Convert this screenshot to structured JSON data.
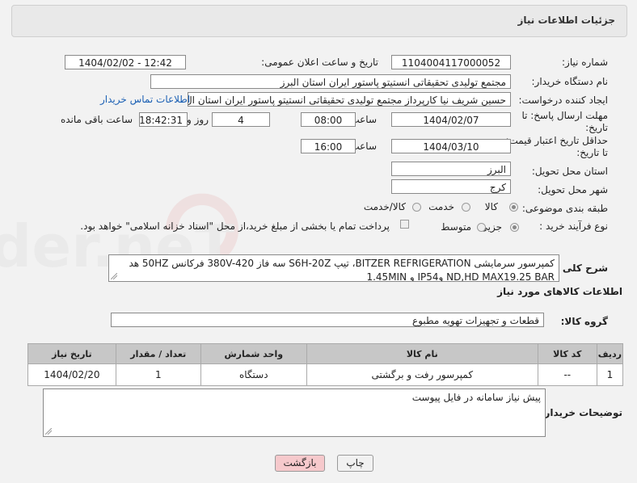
{
  "header": {
    "title": "جزئیات اطلاعات نیاز"
  },
  "need_number": {
    "label": "شماره نیاز:",
    "value": "1104004117000052"
  },
  "announce_datetime": {
    "label": "تاریخ و ساعت اعلان عمومی:",
    "value": "1404/02/02 - 12:42"
  },
  "buyer_org": {
    "label": "نام دستگاه خریدار:",
    "value": "مجتمع تولیدی تحقیقاتی انستیتو پاستور ایران استان البرز"
  },
  "requester": {
    "label": "ایجاد کننده درخواست:",
    "value": "حسین شریف نیا کارپرداز مجتمع تولیدی تحقیقاتی انستیتو پاستور ایران استان ال",
    "contact_link": "اطلاعات تماس خریدار"
  },
  "deadline": {
    "label_line1": "مهلت ارسال پاسخ: تا",
    "label_line2": "تاریخ:",
    "date": "1404/02/07",
    "time_label": "ساعت",
    "time": "08:00",
    "days": "4",
    "days_label": "روز و",
    "remaining": "18:42:31",
    "remaining_label": "ساعت باقی مانده"
  },
  "price_validity": {
    "label_line1": "حداقل تاریخ اعتبار قیمت:",
    "label_line2": "تا تاریخ:",
    "date": "1404/03/10",
    "time_label": "ساعت",
    "time": "16:00"
  },
  "delivery_province": {
    "label": "استان محل تحویل:",
    "value": "البرز"
  },
  "delivery_city": {
    "label": "شهر محل تحویل:",
    "value": "کرج"
  },
  "category": {
    "label": "طبقه بندی موضوعی:",
    "options": [
      "کالا",
      "خدمت",
      "کالا/خدمت"
    ],
    "selected": "کالا"
  },
  "purchase_process": {
    "label": "نوع فرآیند خرید :",
    "options": [
      "جزیی",
      "متوسط"
    ],
    "selected": "جزیی",
    "payment_note": "پرداخت تمام یا بخشی از مبلغ خرید،از محل \"اسناد خزانه اسلامی\" خواهد بود."
  },
  "description": {
    "label": "شرح کلی نیاز:",
    "line1": "کمپرسور سرمایشی BITZER REFRIGERATION، تیپ S6H-20Z سه فاز 380V-420 فرکانس 50HZ هد",
    "line2": "ND,HD MAX19.25 BAR وIP54 و 1.45MIN"
  },
  "goods_section": {
    "title": "اطلاعات کالاهای مورد نیاز"
  },
  "goods_group": {
    "label": "گروه کالا:",
    "value": "قطعات و تجهیزات تهویه مطبوع"
  },
  "table": {
    "headers": [
      "ردیف",
      "کد کالا",
      "نام کالا",
      "واحد شمارش",
      "تعداد / مقدار",
      "تاریخ نیاز"
    ],
    "rows": [
      {
        "index": "1",
        "code": "--",
        "name": "کمپرسور رفت و برگشتی",
        "unit": "دستگاه",
        "qty": "1",
        "date": "1404/02/20"
      }
    ]
  },
  "buyer_notes": {
    "label": "توضیحات خریدار:",
    "value": "پیش نیاز سامانه در فایل پیوست"
  },
  "buttons": {
    "print": "چاپ",
    "back": "بازگشت"
  },
  "colors": {
    "back_button_bg": "#f6c9cc",
    "link": "#1a5fb4",
    "table_header": "#c7c7c7"
  }
}
